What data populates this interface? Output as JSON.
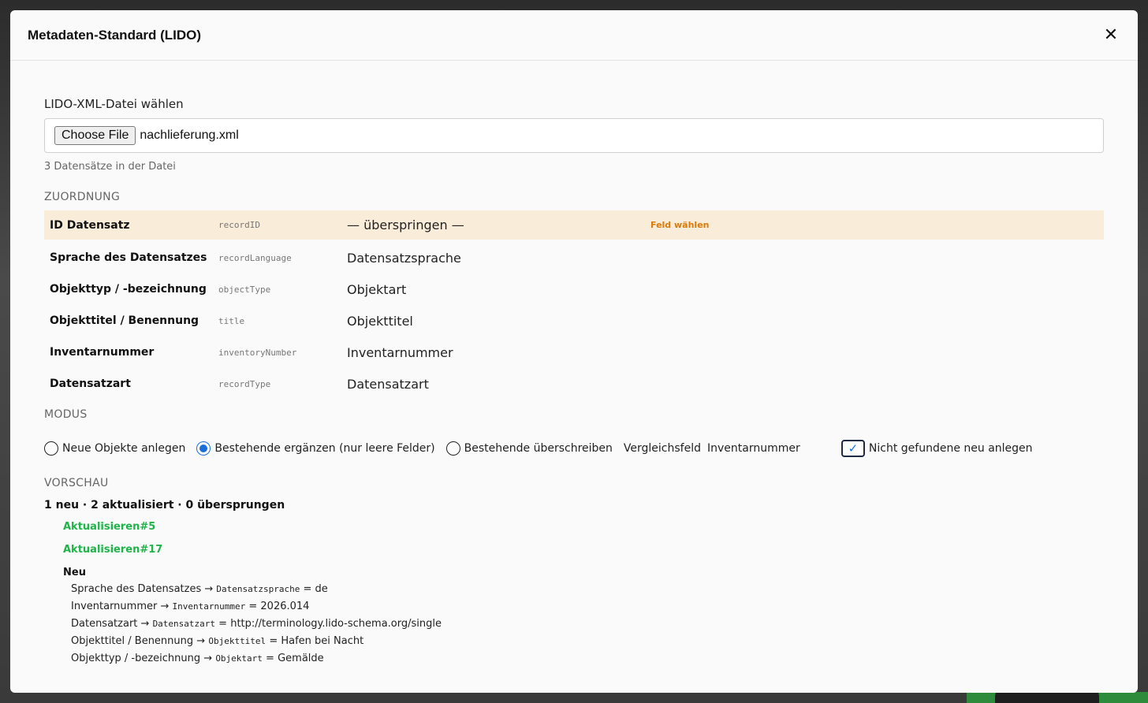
{
  "modal": {
    "title": "Metadaten-Standard (LIDO)",
    "close_glyph": "✕"
  },
  "file": {
    "label": "LIDO-XML-Datei wählen",
    "button": "Choose File",
    "name": "nachlieferung.xml",
    "count_text": "3 Datensätze in der Datei"
  },
  "mapping": {
    "title": "ZUORDNUNG",
    "rows": [
      {
        "label": "ID Datensatz",
        "key": "recordID",
        "target": "— überspringen —",
        "hint": "Feld wählen"
      },
      {
        "label": "Sprache des Datensatzes",
        "key": "recordLanguage",
        "target": "Datensatzsprache",
        "hint": ""
      },
      {
        "label": "Objekttyp / -bezeichnung",
        "key": "objectType",
        "target": "Objektart",
        "hint": ""
      },
      {
        "label": "Objekttitel / Benennung",
        "key": "title",
        "target": "Objekttitel",
        "hint": ""
      },
      {
        "label": "Inventarnummer",
        "key": "inventoryNumber",
        "target": "Inventarnummer",
        "hint": ""
      },
      {
        "label": "Datensatzart",
        "key": "recordType",
        "target": "Datensatzart",
        "hint": ""
      }
    ]
  },
  "mode": {
    "title": "MODUS",
    "options": [
      "Neue Objekte anlegen",
      "Bestehende ergänzen (nur leere Felder)",
      "Bestehende überschreiben"
    ],
    "selected_index": 1,
    "compare_label": "Vergleichsfeld",
    "compare_value": "Inventarnummer",
    "create_missing_label": "Nicht gefundene neu anlegen",
    "create_missing_checked": true
  },
  "preview": {
    "title": "VORSCHAU",
    "summary": "1 neu · 2 aktualisiert · 0 übersprungen",
    "updates": [
      "Aktualisieren#5",
      "Aktualisieren#17"
    ],
    "new_title": "Neu",
    "new_items": [
      {
        "field": "Sprache des Datensatzes",
        "target": "Datensatzsprache",
        "value": "de"
      },
      {
        "field": "Inventarnummer",
        "target": "Inventarnummer",
        "value": "2026.014"
      },
      {
        "field": "Datensatzart",
        "target": "Datensatzart",
        "value": "http://terminology.lido-schema.org/single"
      },
      {
        "field": "Objekttitel / Benennung",
        "target": "Objekttitel",
        "value": "Hafen bei Nacht"
      },
      {
        "field": "Objekttyp / -bezeichnung",
        "target": "Objektart",
        "value": "Gemälde"
      }
    ]
  },
  "colors": {
    "highlight_row": "#f9ecd9",
    "warning": "#d97a0a",
    "update": "#1fb34a",
    "accent": "#1a6fd6"
  }
}
